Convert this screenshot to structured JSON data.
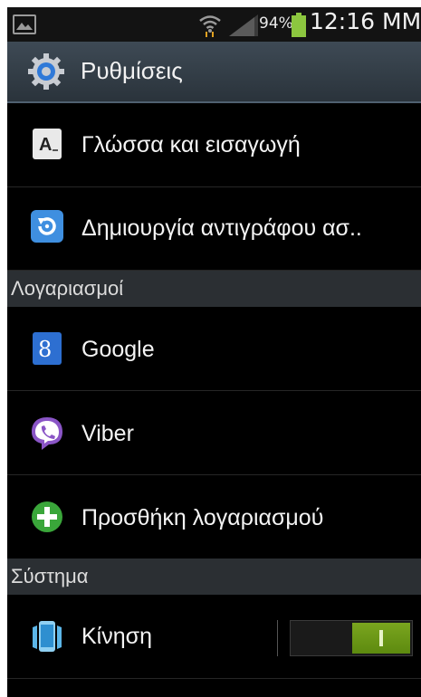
{
  "status_bar": {
    "battery_percent": "94%",
    "time": "12:16 MM"
  },
  "header": {
    "title": "Ρυθμίσεις",
    "icon": "settings-gear-icon"
  },
  "rows_top": [
    {
      "label": "Γλώσσα και εισαγωγή",
      "icon": "language-input-icon"
    },
    {
      "label": "Δημιουργία αντιγράφου ασ..",
      "icon": "backup-icon"
    }
  ],
  "sections": {
    "accounts": "Λογαριασμοί",
    "system": "Σύστημα"
  },
  "accounts": [
    {
      "label": "Google",
      "icon": "google-icon"
    },
    {
      "label": "Viber",
      "icon": "viber-icon"
    },
    {
      "label": "Προσθήκη λογαριασμού",
      "icon": "add-account-icon"
    }
  ],
  "system": [
    {
      "label": "Κίνηση",
      "icon": "motion-icon",
      "toggle_on": true
    }
  ],
  "colors": {
    "toggle_on": "#6b9a16",
    "header_bg": "#333d46",
    "section_bg": "#2b2f33"
  }
}
